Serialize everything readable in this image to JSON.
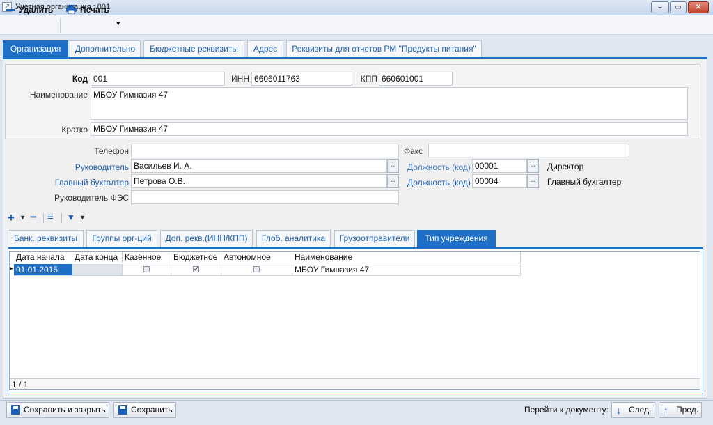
{
  "window": {
    "title": "Учетная организация : 001",
    "app_icon": "app-icon",
    "minimize_glyph": "–",
    "restore_glyph": "▭",
    "close_glyph": "✕"
  },
  "toolbar": {
    "delete_label": "Удалить",
    "print_label": "Печать",
    "print_icon": "printer-icon",
    "dropdown_glyph": "▾"
  },
  "tabs": [
    {
      "label": "Организация",
      "active": true
    },
    {
      "label": "Дополнительно"
    },
    {
      "label": "Бюджетные реквизиты"
    },
    {
      "label": "Адрес"
    },
    {
      "label": "Реквизиты для отчетов РМ \"Продукты питания\""
    }
  ],
  "org": {
    "code_label": "Код",
    "code": "001",
    "inn_label": "ИНН",
    "inn": "6606011763",
    "kpp_label": "КПП",
    "kpp": "660601001",
    "name_label": "Наименование",
    "name": "МБОУ Гимназия 47",
    "short_label": "Кратко",
    "short": "МБОУ Гимназия 47"
  },
  "contacts": {
    "phone_label": "Телефон",
    "phone": "",
    "fax_label": "Факс",
    "fax": "",
    "head_label": "Руководитель",
    "head": "Васильев И. А.",
    "head_pos_label": "Должность (код)",
    "head_pos_code": "00001",
    "head_pos_name": "Директор",
    "accountant_label": "Главный бухгалтер",
    "accountant": "Петрова О.В.",
    "acc_pos_label": "Должность (код)",
    "acc_pos_code": "00004",
    "acc_pos_name": "Главный бухгалтер",
    "fes_head_label": "Руководитель ФЭС",
    "fes_head": "",
    "ellipsis": "..."
  },
  "subtoolbar": {
    "add_glyph": "+",
    "dropdown_glyph": "▾",
    "remove_glyph": "−",
    "list_glyph": "≡",
    "filter_glyph": "▼"
  },
  "subtabs": [
    {
      "label": "Банк. реквизиты"
    },
    {
      "label": "Группы орг-ций"
    },
    {
      "label": "Доп. рекв.(ИНН/КПП)"
    },
    {
      "label": "Глоб. аналитика"
    },
    {
      "label": "Грузоотправители"
    },
    {
      "label": "Тип учреждения",
      "active": true
    }
  ],
  "grid": {
    "columns": [
      "Дата начала",
      "Дата конца",
      "Казённое",
      "Бюджетное",
      "Автономное",
      "Наименование"
    ],
    "rows": [
      {
        "start": "01.01.2015",
        "end": "",
        "kazennoe": false,
        "budgetnoe": true,
        "avtonomnoe": false,
        "name": "МБОУ Гимназия 47"
      }
    ],
    "row_marker": "▸",
    "check_glyph": "✓",
    "footer": "1 / 1"
  },
  "bottom": {
    "save_close_label": "Сохранить и закрыть",
    "save_label": "Сохранить",
    "goto_label": "Перейти к документу:",
    "next_label": "След.",
    "prev_label": "Пред.",
    "down_glyph": "↓",
    "up_glyph": "↑"
  },
  "colors": {
    "accent": "#1f6fc6",
    "link": "#1d5fb5"
  }
}
